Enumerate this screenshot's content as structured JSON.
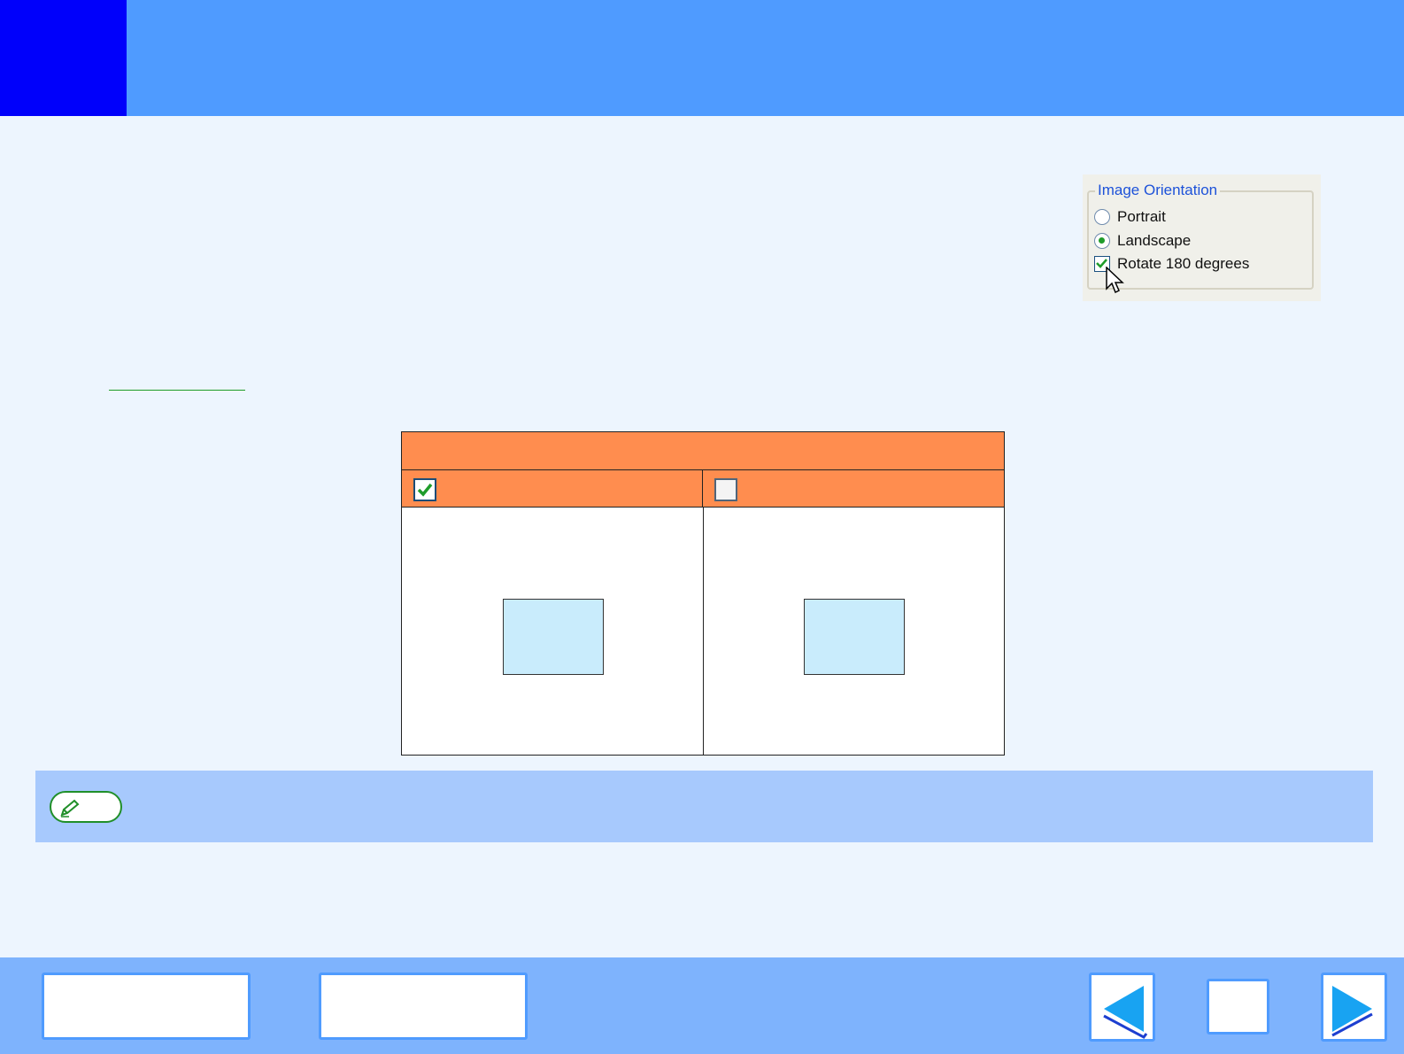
{
  "dialog": {
    "group_title": "Image Orientation",
    "options": [
      {
        "label": "Portrait",
        "type": "radio",
        "selected": false
      },
      {
        "label": "Landscape",
        "type": "radio",
        "selected": true
      },
      {
        "label": "Rotate 180 degrees",
        "type": "checkbox",
        "checked": true
      }
    ]
  },
  "table": {
    "left_checked": true,
    "right_checked": false
  },
  "colors": {
    "header": "#4f9bff",
    "chapter_tab": "#0000fb",
    "table_header": "#ff8d4f",
    "note_bar": "#a7c9fd",
    "footer": "#7eb3fd",
    "page_sample": "#c9ecfc"
  },
  "icons": {
    "note": "pencil-icon",
    "back": "left-arrow-icon",
    "forward": "right-arrow-icon",
    "checkmark": "checkmark-icon",
    "cursor": "mouse-cursor-icon"
  }
}
